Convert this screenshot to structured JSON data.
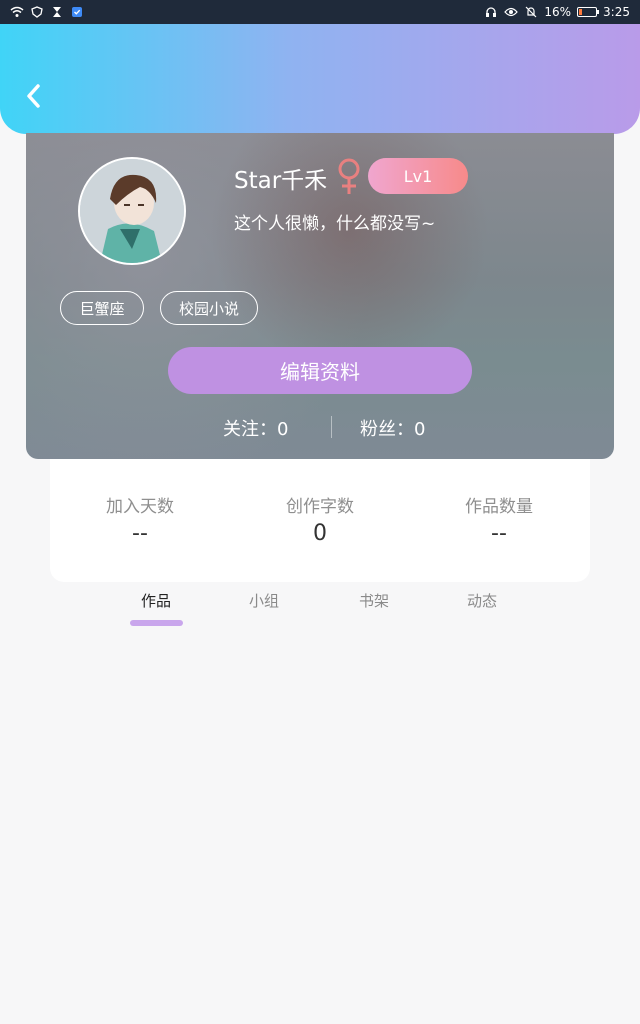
{
  "status_bar": {
    "battery_percent": "16%",
    "time": "3:25",
    "icons_left": [
      "wifi-icon",
      "shield-icon",
      "hourglass-icon",
      "security-badge-icon"
    ],
    "icons_right": [
      "headphones-icon",
      "eye-icon",
      "bell-off-icon",
      "battery-icon"
    ],
    "battery_level": 0.16
  },
  "header": {
    "back_icon": "chevron-left-icon",
    "gradient_colors": [
      "#40d4f7",
      "#b99be9"
    ]
  },
  "profile": {
    "username": "Star千禾",
    "gender_symbol": "♀",
    "level": "Lv1",
    "bio": "这个人很懒，什么都没写~",
    "tags": [
      "巨蟹座",
      "校园小说"
    ],
    "edit_button": "编辑资料",
    "following": "关注：0",
    "followers": "粉丝：0"
  },
  "stats": [
    {
      "label": "加入天数",
      "value": "--"
    },
    {
      "label": "创作字数",
      "value": "0"
    },
    {
      "label": "作品数量",
      "value": "--"
    }
  ],
  "tabs": [
    {
      "label": "作品",
      "active": true
    },
    {
      "label": "小组",
      "active": false
    },
    {
      "label": "书架",
      "active": false
    },
    {
      "label": "动态",
      "active": false
    }
  ],
  "colors": {
    "edit_button": "#bf91e2",
    "level_badge_start": "#f0a6cf",
    "level_badge_end": "#f78a8a",
    "tab_indicator": "#c9a6ec"
  }
}
